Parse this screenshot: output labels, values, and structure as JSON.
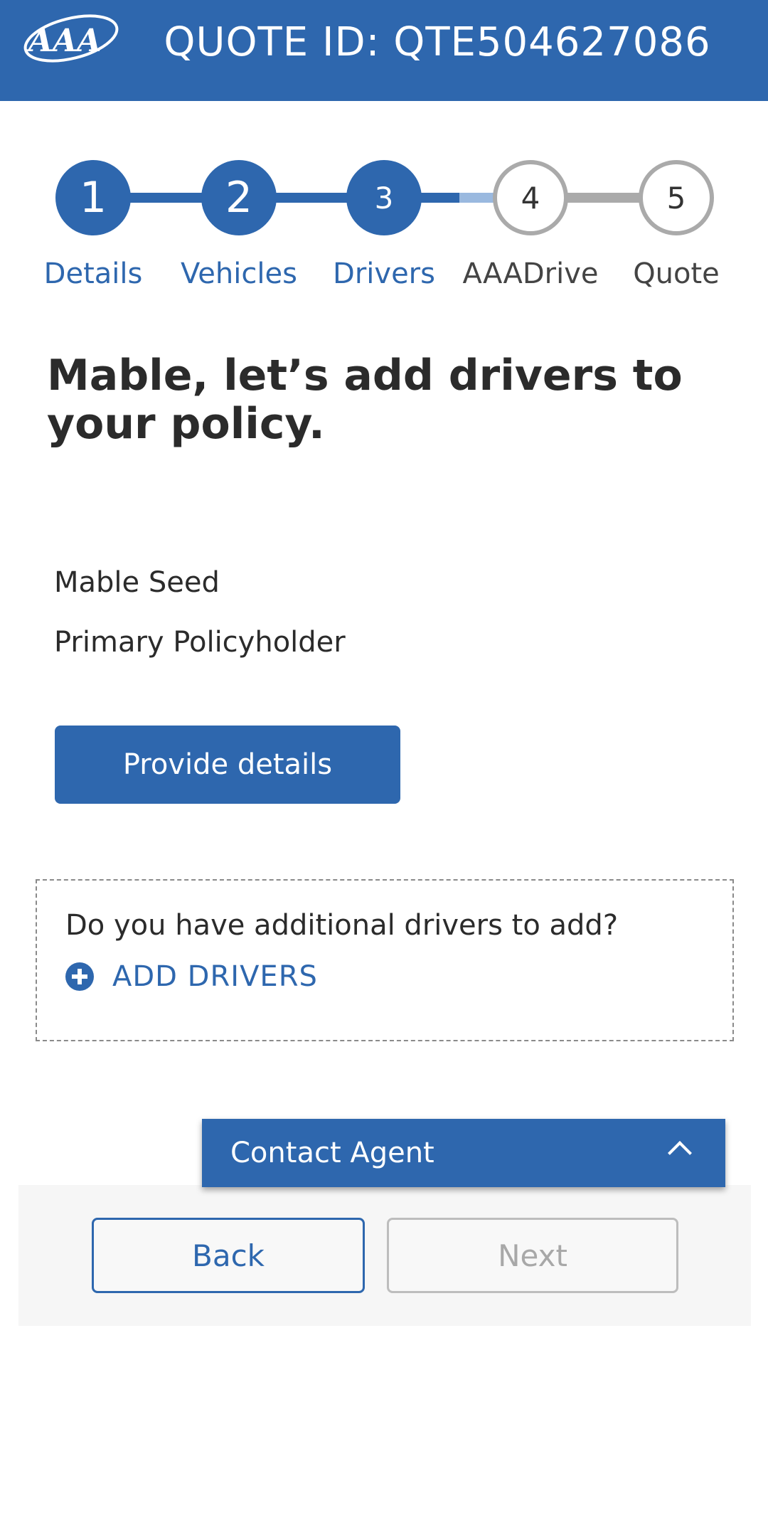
{
  "header": {
    "quote_id_text": "QUOTE ID: QTE504627086",
    "logo_text": "AAA",
    "bg_color": "#2e67ae"
  },
  "stepper": {
    "steps": [
      {
        "number": "1",
        "label": "Details",
        "state": "complete"
      },
      {
        "number": "2",
        "label": "Vehicles",
        "state": "complete"
      },
      {
        "number": "3",
        "label": "Drivers",
        "state": "current"
      },
      {
        "number": "4",
        "label": "AAADrive",
        "state": "upcoming"
      },
      {
        "number": "5",
        "label": "Quote",
        "state": "upcoming"
      }
    ]
  },
  "main": {
    "title": "Mable, let’s add drivers to your policy.",
    "driver": {
      "name": "Mable Seed",
      "role": "Primary Policyholder"
    },
    "provide_details_label": "Provide details",
    "add_drivers": {
      "question": "Do you have additional drivers to add?",
      "link_label": "ADD DRIVERS",
      "icon": "plus-circle-icon"
    }
  },
  "contact_agent": {
    "label": "Contact Agent",
    "icon": "chevron-up-icon"
  },
  "footer": {
    "back_label": "Back",
    "next_label": "Next"
  },
  "colors": {
    "accent": "#2e67ae",
    "disabled": "#bdbdbd"
  }
}
